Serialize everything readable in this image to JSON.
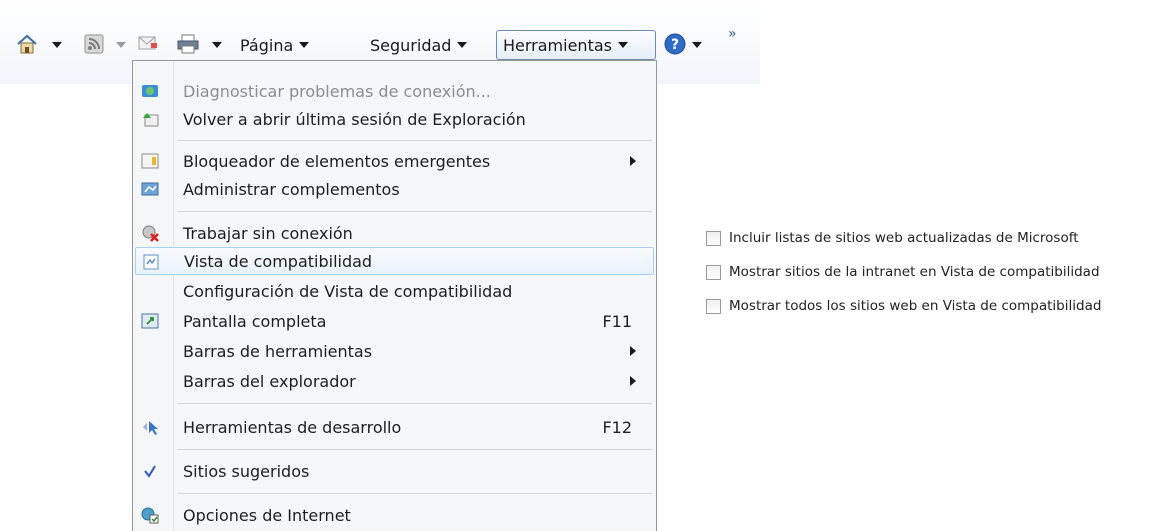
{
  "toolbar": {
    "items": [
      {
        "name": "home-icon"
      },
      {
        "name": "feeds-icon"
      },
      {
        "name": "mail-icon"
      },
      {
        "name": "print-icon"
      }
    ],
    "page_label": "Página",
    "security_label": "Seguridad",
    "tools_label": "Herramientas",
    "help_icon": "help-icon",
    "more": "»"
  },
  "menu": {
    "items": [
      {
        "label": "Diagnosticar problemas de conexión...",
        "icon": "network-diagnose-icon",
        "disabled": true
      },
      {
        "label": "Volver a abrir última sesión de Exploración",
        "icon": "reopen-session-icon"
      },
      {
        "label": "Bloqueador de elementos emergentes",
        "icon": "popup-blocker-icon",
        "submenu": true
      },
      {
        "label": "Administrar complementos",
        "icon": "addons-icon"
      },
      {
        "label": "Trabajar sin conexión",
        "icon": "offline-icon"
      },
      {
        "label": "Vista de compatibilidad",
        "icon": "compatibility-view-icon",
        "highlighted": true
      },
      {
        "label": "Configuración de Vista de compatibilidad"
      },
      {
        "label": "Pantalla completa",
        "icon": "fullscreen-icon",
        "shortcut": "F11"
      },
      {
        "label": "Barras de herramientas",
        "submenu": true
      },
      {
        "label": "Barras del explorador",
        "submenu": true
      },
      {
        "label": "Herramientas de desarrollo",
        "icon": "developer-tools-icon",
        "shortcut": "F12"
      },
      {
        "label": "Sitios sugeridos",
        "icon": "checkmark-icon",
        "checked": true
      },
      {
        "label": "Opciones de Internet",
        "icon": "internet-options-icon"
      }
    ]
  },
  "compat_settings": {
    "options": [
      {
        "label": "Incluir listas de sitios web actualizadas de Microsoft",
        "checked": false
      },
      {
        "label": "Mostrar sitios de la intranet en Vista de compatibilidad",
        "checked": false
      },
      {
        "label": "Mostrar todos los sitios web en Vista de compatibilidad",
        "checked": false
      }
    ]
  }
}
